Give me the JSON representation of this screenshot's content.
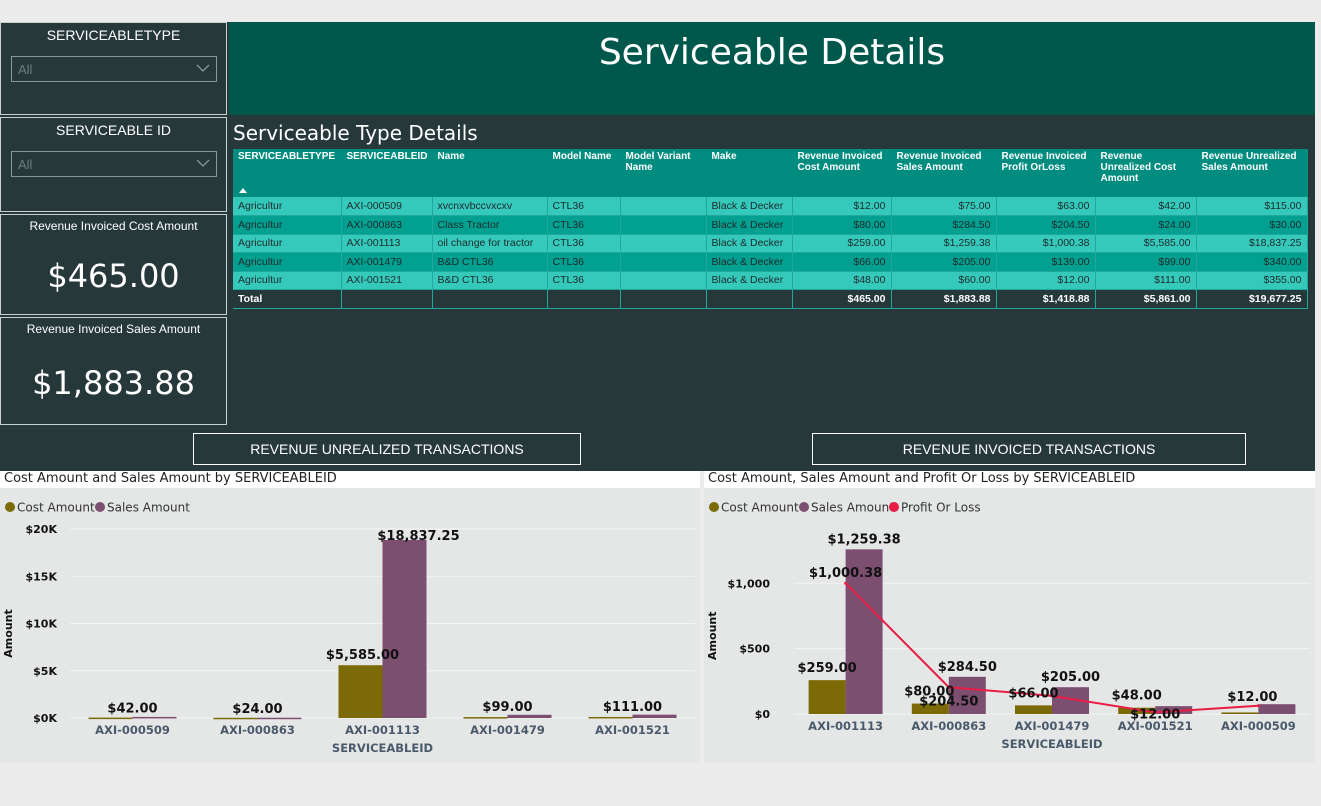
{
  "slicers": [
    {
      "title": "SERVICEABLETYPE",
      "value": "All"
    },
    {
      "title": "SERVICEABLE ID",
      "value": "All"
    }
  ],
  "cards": [
    {
      "label": "Revenue Invoiced Cost Amount",
      "value": "$465.00"
    },
    {
      "label": "Revenue Invoiced Sales Amount",
      "value": "$1,883.88"
    }
  ],
  "header": {
    "title": "Serviceable Details"
  },
  "table": {
    "title": "Serviceable Type Details",
    "columns": [
      "SERVICEABLETYPE",
      "SERVICEABLEID",
      "Name",
      "Model Name",
      "Model Variant Name",
      "Make",
      "Revenue Invoiced Cost Amount",
      "Revenue Invoiced Sales Amount",
      "Revenue Invoiced Profit OrLoss",
      "Revenue Unrealized Cost Amount",
      "Revenue Unrealized Sales Amount"
    ],
    "rows": [
      [
        "Agricultur",
        "AXI-000509",
        "xvcnxvbccvxcxv",
        "CTL36",
        "",
        "Black & Decker",
        "$12.00",
        "$75.00",
        "$63.00",
        "$42.00",
        "$115.00"
      ],
      [
        "Agricultur",
        "AXI-000863",
        "Class Tractor",
        "CTL36",
        "",
        "Black & Decker",
        "$80.00",
        "$284.50",
        "$204.50",
        "$24.00",
        "$30.00"
      ],
      [
        "Agricultur",
        "AXI-001113",
        "oil change for tractor",
        "CTL36",
        "",
        "Black & Decker",
        "$259.00",
        "$1,259.38",
        "$1,000.38",
        "$5,585.00",
        "$18,837.25"
      ],
      [
        "Agricultur",
        "AXI-001479",
        "B&D CTL36",
        "CTL36",
        "",
        "Black & Decker",
        "$66.00",
        "$205.00",
        "$139.00",
        "$99.00",
        "$340.00"
      ],
      [
        "Agricultur",
        "AXI-001521",
        "B&D CTL36",
        "CTL36",
        "",
        "Black & Decker",
        "$48.00",
        "$60.00",
        "$12.00",
        "$111.00",
        "$355.00"
      ]
    ],
    "total": [
      "Total",
      "",
      "",
      "",
      "",
      "",
      "$465.00",
      "$1,883.88",
      "$1,418.88",
      "$5,861.00",
      "$19,677.25"
    ]
  },
  "buttons": {
    "unrealized": "REVENUE UNREALIZED TRANSACTIONS",
    "invoiced": "REVENUE INVOICED TRANSACTIONS"
  },
  "colors": {
    "cost": "#7b6a05",
    "sales": "#7c4f70",
    "profit": "#e81c44",
    "teal_header": "#00574b"
  },
  "chart_data": [
    {
      "type": "bar",
      "title": "Cost Amount and Sales Amount by SERVICEABLEID",
      "xlabel": "SERVICEABLEID",
      "ylabel": "Amount",
      "categories": [
        "AXI-000509",
        "AXI-000863",
        "AXI-001113",
        "AXI-001479",
        "AXI-001521"
      ],
      "series": [
        {
          "name": "Cost Amount",
          "values": [
            42,
            24,
            5585,
            99,
            111
          ],
          "labels": [
            "$42.00",
            "$24.00",
            "$5,585.00",
            "$99.00",
            "$111.00"
          ]
        },
        {
          "name": "Sales Amount",
          "values": [
            115,
            30,
            18837.25,
            340,
            355
          ],
          "labels": [
            "",
            "",
            "$18,837.25",
            "",
            ""
          ]
        }
      ],
      "ylim": [
        0,
        20000
      ],
      "yticks": [
        0,
        5000,
        10000,
        15000,
        20000
      ],
      "ytick_labels": [
        "$0K",
        "$5K",
        "$10K",
        "$15K",
        "$20K"
      ],
      "legend": "top-left",
      "grid": true
    },
    {
      "type": "bar",
      "title": "Cost Amount, Sales Amount and Profit Or Loss by SERVICEABLEID",
      "xlabel": "SERVICEABLEID",
      "ylabel": "Amount",
      "categories": [
        "AXI-001113",
        "AXI-000863",
        "AXI-001479",
        "AXI-001521",
        "AXI-000509"
      ],
      "series": [
        {
          "name": "Cost Amount",
          "values": [
            259,
            80,
            66,
            48,
            12
          ],
          "labels": [
            "$259.00",
            "$80.00",
            "$66.00",
            "$48.00",
            ""
          ]
        },
        {
          "name": "Sales Amount",
          "values": [
            1259.38,
            284.5,
            205,
            60,
            75
          ],
          "labels": [
            "$1,259.38",
            "$284.50",
            "$205.00",
            "",
            ""
          ]
        },
        {
          "name": "Profit Or Loss",
          "type": "line",
          "values": [
            1000.38,
            204.5,
            139,
            12,
            63
          ],
          "labels": [
            "$1,000.38",
            "$204.50",
            "",
            "$12.00",
            "$12.00"
          ]
        }
      ],
      "ylim": [
        0,
        1350
      ],
      "yticks": [
        0,
        500,
        1000
      ],
      "ytick_labels": [
        "$0",
        "$500",
        "$1,000"
      ],
      "legend": "top-left",
      "grid": true
    }
  ]
}
